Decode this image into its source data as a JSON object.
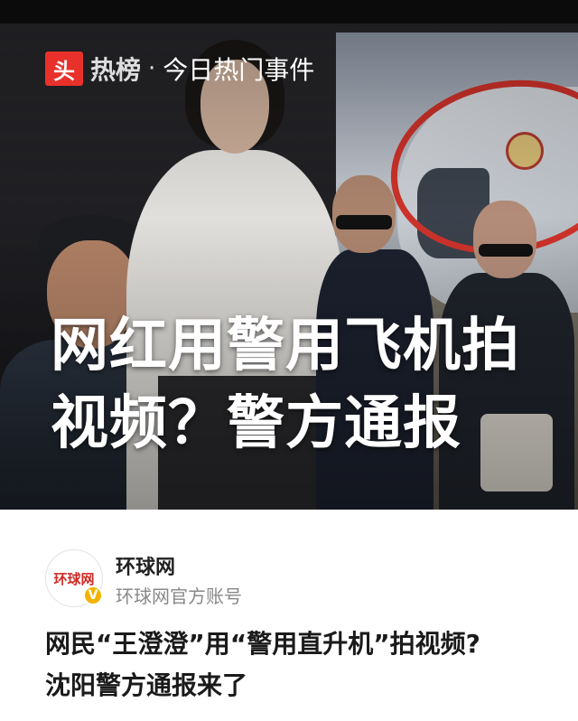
{
  "header": {
    "logo_char": "头",
    "list_name": "热榜",
    "separator": "·",
    "subtitle": "今日热门事件"
  },
  "hero": {
    "headline_line1": "网红用警用飞机拍",
    "headline_line2": "视频？警方通报"
  },
  "account": {
    "avatar_text": "环球网",
    "name": "环球网",
    "description": "环球网官方账号",
    "verified_mark": "V"
  },
  "article": {
    "title_line1": "网民“王澄澄”用“警用直升机”拍视频?",
    "title_line2": "沈阳警方通报来了"
  },
  "colors": {
    "accent_red": "#e8312a",
    "ring_red": "#d8352c",
    "verified_gold": "#f2b300"
  }
}
